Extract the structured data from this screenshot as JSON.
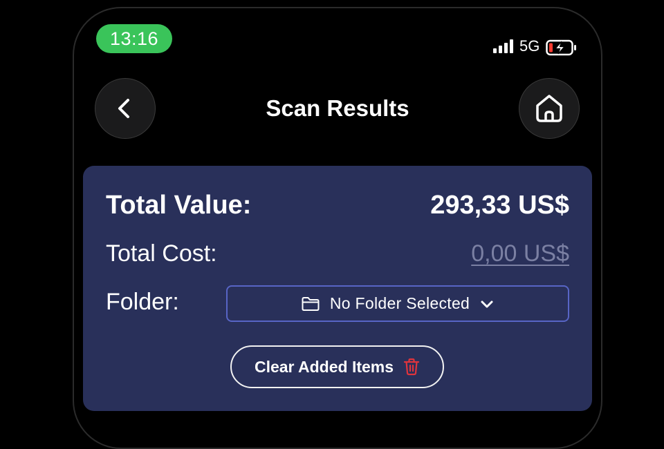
{
  "status_bar": {
    "time": "13:16",
    "network": "5G",
    "icons": [
      "signal-icon",
      "battery-charging-icon"
    ],
    "time_pill_color": "#3ac45a",
    "battery_low_color": "#ff3b30"
  },
  "header": {
    "title": "Scan Results",
    "back_icon": "chevron-left-icon",
    "home_icon": "home-icon"
  },
  "summary": {
    "total_value_label": "Total Value:",
    "total_value": "293,33 US$",
    "total_cost_label": "Total Cost:",
    "total_cost": "0,00 US$",
    "folder_label": "Folder:",
    "folder_select": {
      "value": "No Folder Selected",
      "icon": "folder-icon",
      "dropdown_icon": "chevron-down-icon"
    },
    "clear_button": {
      "label": "Clear Added Items",
      "icon": "trash-icon",
      "icon_color": "#e0343c"
    }
  },
  "colors": {
    "background": "#000000",
    "card": "#29305a",
    "folder_border": "#5865c6",
    "muted_text": "#7b80a3"
  }
}
